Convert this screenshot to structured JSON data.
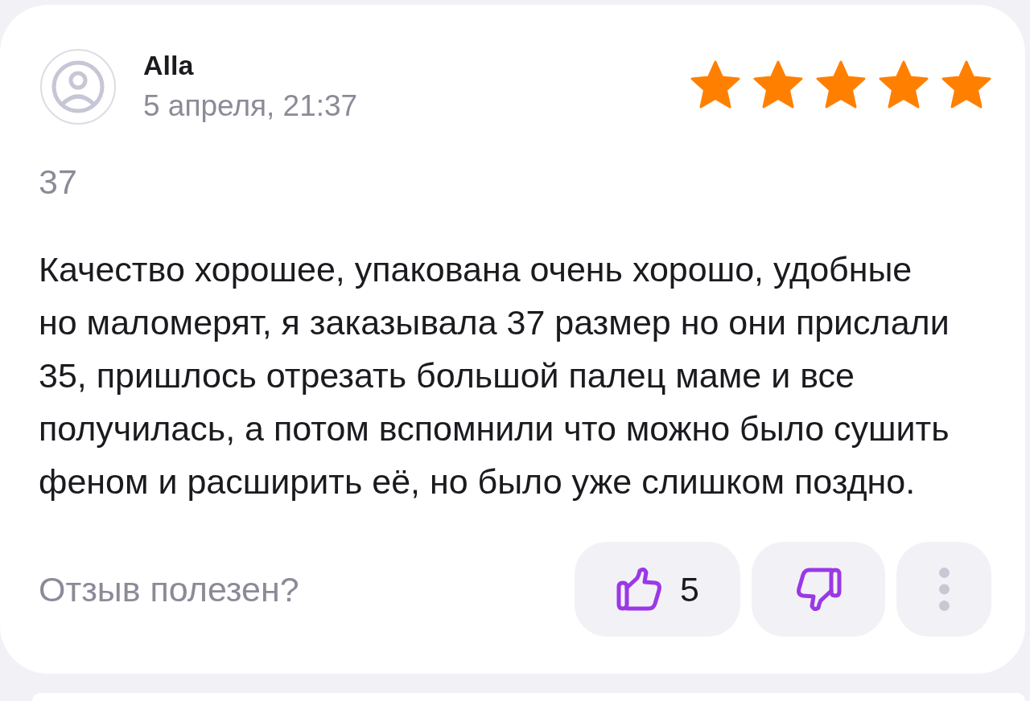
{
  "review": {
    "author": "Alla",
    "date": "5 апреля, 21:37",
    "stars": 5,
    "size": "37",
    "text": "Качество хорошее, упакована очень хорошо, удобные но маломерят, я заказывала 37 размер но они прислали 35, пришлось отрезать большой палец маме и все получилась, а потом вспомнили что можно было сушить феном и расширить её, но было уже слишком поздно.",
    "helpful_prompt": "Отзыв полезен?",
    "likes": "5"
  }
}
